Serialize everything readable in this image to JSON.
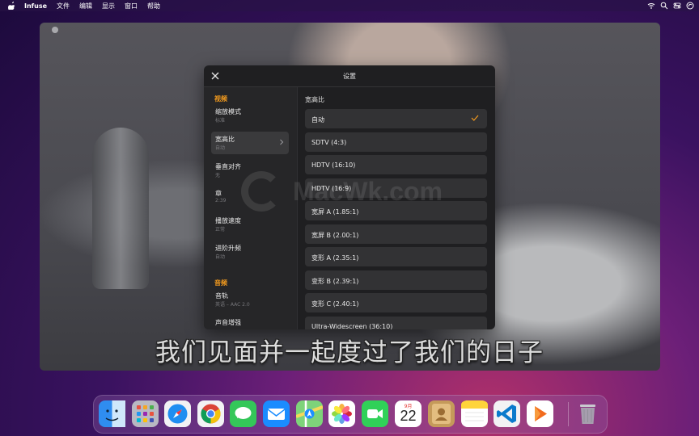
{
  "menubar": {
    "app_name": "Infuse",
    "items": [
      "文件",
      "编辑",
      "显示",
      "窗口",
      "帮助"
    ]
  },
  "dialog": {
    "title": "设置",
    "sidebar": {
      "sections": [
        {
          "label": "视频",
          "items": [
            {
              "title": "缩放模式",
              "subtitle": "标准"
            },
            {
              "title": "宽高比",
              "subtitle": "自动"
            },
            {
              "title": "垂直对齐",
              "subtitle": "无"
            },
            {
              "title": "章",
              "subtitle": "2:39"
            },
            {
              "title": "播放速度",
              "subtitle": "正常"
            },
            {
              "title": "进阶升频",
              "subtitle": "自动"
            }
          ]
        },
        {
          "label": "音频",
          "items": [
            {
              "title": "音轨",
              "subtitle": "英语 – AAC 2.0"
            },
            {
              "title": "声音增强",
              "subtitle": ""
            }
          ]
        }
      ]
    },
    "content": {
      "title": "宽高比",
      "options": [
        "自动",
        "SDTV (4:3)",
        "HDTV (16:10)",
        "HDTV (16:9)",
        "宽屏 A (1.85:1)",
        "宽屏 B (2.00:1)",
        "变形 A (2.35:1)",
        "变形 B (2.39:1)",
        "变形 C (2.40:1)",
        "Ultra-Widescreen (36:10)"
      ],
      "selected": "自动"
    }
  },
  "watermark": "MacWk.com",
  "subtitle": "我们见面并一起度过了我们的日子",
  "dock": {
    "apps": [
      "finder-icon",
      "launchpad-icon",
      "safari-icon",
      "chrome-icon",
      "messages-icon",
      "mail-icon",
      "maps-icon",
      "photos-icon",
      "facetime-icon",
      "calendar-icon",
      "contacts-icon",
      "notes-icon",
      "vscode-icon",
      "infuse-icon",
      "trash-icon"
    ],
    "calendar_month": "9月",
    "calendar_day": "22"
  },
  "colors": {
    "accent": "#f29a1e",
    "dialog_bg": "#1f1f21",
    "sidebar_bg": "#262628",
    "option_bg": "#323234"
  }
}
